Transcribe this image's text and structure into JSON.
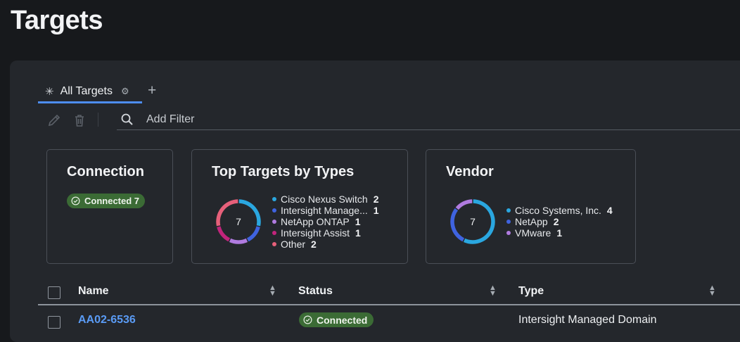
{
  "page": {
    "title": "Targets"
  },
  "tabs": {
    "active": {
      "label": "All Targets",
      "icon": "asterisk-icon",
      "settings_icon": "gear-icon"
    },
    "add_icon": "plus-icon"
  },
  "toolbar": {
    "edit_icon": "pencil-icon",
    "delete_icon": "trash-icon",
    "search_icon": "search-icon",
    "filter_placeholder": "Add Filter"
  },
  "cards": {
    "connection": {
      "title": "Connection",
      "badge": "Connected 7",
      "color": "#3b6b35"
    },
    "types": {
      "title": "Top Targets by Types",
      "total": "7",
      "items": [
        {
          "label": "Cisco Nexus Switch",
          "count": "2",
          "value": 2,
          "color": "#2aa7e0"
        },
        {
          "label": "Intersight Manage...",
          "count": "1",
          "value": 1,
          "color": "#3f63e0"
        },
        {
          "label": "NetApp ONTAP",
          "count": "1",
          "value": 1,
          "color": "#b07be0"
        },
        {
          "label": "Intersight Assist",
          "count": "1",
          "value": 1,
          "color": "#c2247c"
        },
        {
          "label": "Other",
          "count": "2",
          "value": 2,
          "color": "#e6607a"
        }
      ]
    },
    "vendor": {
      "title": "Vendor",
      "total": "7",
      "items": [
        {
          "label": "Cisco Systems, Inc.",
          "count": "4",
          "value": 4,
          "color": "#2aa7e0"
        },
        {
          "label": "NetApp",
          "count": "2",
          "value": 2,
          "color": "#3f63e0"
        },
        {
          "label": "VMware",
          "count": "1",
          "value": 1,
          "color": "#b07be0"
        }
      ]
    }
  },
  "table": {
    "columns": [
      {
        "label": "Name"
      },
      {
        "label": "Status"
      },
      {
        "label": "Type"
      }
    ],
    "rows": [
      {
        "name": "AA02-6536",
        "status": "Connected",
        "type": "Intersight Managed Domain"
      }
    ],
    "status_color": "#3b6b35"
  }
}
